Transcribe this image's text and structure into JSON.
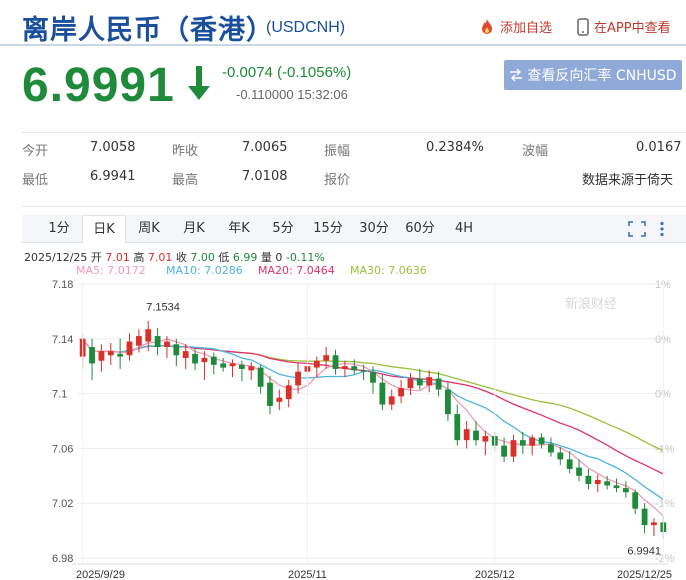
{
  "header": {
    "title": "离岸人民币（香港）",
    "symbol": "(USDCNH)",
    "add_favorite": "添加自选",
    "view_in_app": "在APP中查看"
  },
  "quote": {
    "price": "6.9991",
    "change": "-0.0074 (-0.1056%)",
    "change2": "-0.110000",
    "time": "15:32:06",
    "reverse_label": "查看反向汇率 CNHUSD"
  },
  "stats": {
    "open_label": "今开",
    "open": "7.0058",
    "prev_close_label": "昨收",
    "prev_close": "7.0065",
    "amplitude_label": "振幅",
    "amplitude": "0.2384%",
    "volatility_label": "波幅",
    "volatility": "0.0167",
    "low_label": "最低",
    "low": "6.9941",
    "high_label": "最高",
    "high": "7.0108",
    "quote_label": "报价",
    "source": "数据来源于倚天"
  },
  "tabs": [
    {
      "label": "1分",
      "active": false
    },
    {
      "label": "日K",
      "active": true
    },
    {
      "label": "周K",
      "active": false
    },
    {
      "label": "月K",
      "active": false
    },
    {
      "label": "年K",
      "active": false
    },
    {
      "label": "5分",
      "active": false
    },
    {
      "label": "15分",
      "active": false
    },
    {
      "label": "30分",
      "active": false
    },
    {
      "label": "60分",
      "active": false
    },
    {
      "label": "4H",
      "active": false
    }
  ],
  "ohlc": {
    "date": "2025/12/25",
    "open_label": "开",
    "open": "7.01",
    "high_label": "高",
    "high": "7.01",
    "close_label": "收",
    "close": "7.00",
    "low_label": "低",
    "low": "6.99",
    "volume_label": "量",
    "volume": "0",
    "pct": "-0.11%"
  },
  "ma": {
    "ma5": "MA5: 7.0172",
    "ma10": "MA10: 7.0286",
    "ma20": "MA20: 7.0464",
    "ma30": "MA30: 7.0636"
  },
  "colors": {
    "up": "#d9302a",
    "down": "#1f8a3a",
    "ma5": "#f39ab8",
    "ma10": "#4fb3e0",
    "ma20": "#e0336b",
    "ma30": "#9ac13b",
    "brand": "#1a4f9e"
  },
  "chart_data": {
    "type": "candlestick",
    "y_ticks": [
      "7.18",
      "7.14",
      "7.1",
      "7.06",
      "7.02",
      "6.98"
    ],
    "y_tick_values": [
      7.18,
      7.14,
      7.1,
      7.06,
      7.02,
      6.98
    ],
    "ylim": [
      6.98,
      7.18
    ],
    "right_ticks": [
      "1%",
      "0%",
      "0%",
      "-1%",
      "-1%",
      "-2%"
    ],
    "x_ticks": [
      {
        "label": "2025/9/29",
        "index": 0
      },
      {
        "label": "2025/11",
        "index": 24
      },
      {
        "label": "2025/12",
        "index": 44
      },
      {
        "label": "2025/12/25",
        "index": 62
      }
    ],
    "max_annotation": {
      "label": "7.1534",
      "index": 7,
      "value": 7.1534
    },
    "min_annotation": {
      "label": "6.9941",
      "index": 62,
      "value": 6.9941
    },
    "watermark": "新浪财经",
    "candles": [
      {
        "o": 7.127,
        "h": 7.143,
        "l": 7.118,
        "c": 7.14
      },
      {
        "o": 7.134,
        "h": 7.14,
        "l": 7.11,
        "c": 7.122
      },
      {
        "o": 7.124,
        "h": 7.136,
        "l": 7.116,
        "c": 7.131
      },
      {
        "o": 7.128,
        "h": 7.137,
        "l": 7.121,
        "c": 7.131
      },
      {
        "o": 7.129,
        "h": 7.14,
        "l": 7.118,
        "c": 7.127
      },
      {
        "o": 7.128,
        "h": 7.144,
        "l": 7.124,
        "c": 7.138
      },
      {
        "o": 7.135,
        "h": 7.147,
        "l": 7.13,
        "c": 7.142
      },
      {
        "o": 7.138,
        "h": 7.153,
        "l": 7.131,
        "c": 7.147
      },
      {
        "o": 7.142,
        "h": 7.148,
        "l": 7.128,
        "c": 7.134
      },
      {
        "o": 7.134,
        "h": 7.142,
        "l": 7.126,
        "c": 7.138
      },
      {
        "o": 7.136,
        "h": 7.14,
        "l": 7.12,
        "c": 7.128
      },
      {
        "o": 7.126,
        "h": 7.136,
        "l": 7.118,
        "c": 7.131
      },
      {
        "o": 7.129,
        "h": 7.133,
        "l": 7.117,
        "c": 7.122
      },
      {
        "o": 7.123,
        "h": 7.131,
        "l": 7.11,
        "c": 7.126
      },
      {
        "o": 7.127,
        "h": 7.13,
        "l": 7.114,
        "c": 7.121
      },
      {
        "o": 7.122,
        "h": 7.126,
        "l": 7.116,
        "c": 7.119
      },
      {
        "o": 7.12,
        "h": 7.125,
        "l": 7.112,
        "c": 7.122
      },
      {
        "o": 7.121,
        "h": 7.124,
        "l": 7.109,
        "c": 7.118
      },
      {
        "o": 7.117,
        "h": 7.123,
        "l": 7.11,
        "c": 7.12
      },
      {
        "o": 7.119,
        "h": 7.121,
        "l": 7.1,
        "c": 7.105
      },
      {
        "o": 7.108,
        "h": 7.113,
        "l": 7.085,
        "c": 7.091
      },
      {
        "o": 7.094,
        "h": 7.103,
        "l": 7.088,
        "c": 7.097
      },
      {
        "o": 7.096,
        "h": 7.11,
        "l": 7.09,
        "c": 7.106
      },
      {
        "o": 7.106,
        "h": 7.122,
        "l": 7.1,
        "c": 7.116
      },
      {
        "o": 7.116,
        "h": 7.127,
        "l": 7.108,
        "c": 7.12
      },
      {
        "o": 7.119,
        "h": 7.127,
        "l": 7.112,
        "c": 7.124
      },
      {
        "o": 7.124,
        "h": 7.134,
        "l": 7.118,
        "c": 7.128
      },
      {
        "o": 7.128,
        "h": 7.132,
        "l": 7.114,
        "c": 7.118
      },
      {
        "o": 7.118,
        "h": 7.124,
        "l": 7.112,
        "c": 7.12
      },
      {
        "o": 7.12,
        "h": 7.125,
        "l": 7.114,
        "c": 7.117
      },
      {
        "o": 7.117,
        "h": 7.121,
        "l": 7.11,
        "c": 7.116
      },
      {
        "o": 7.116,
        "h": 7.12,
        "l": 7.1,
        "c": 7.108
      },
      {
        "o": 7.108,
        "h": 7.114,
        "l": 7.088,
        "c": 7.092
      },
      {
        "o": 7.092,
        "h": 7.103,
        "l": 7.088,
        "c": 7.098
      },
      {
        "o": 7.098,
        "h": 7.11,
        "l": 7.093,
        "c": 7.104
      },
      {
        "o": 7.104,
        "h": 7.115,
        "l": 7.099,
        "c": 7.111
      },
      {
        "o": 7.111,
        "h": 7.118,
        "l": 7.103,
        "c": 7.106
      },
      {
        "o": 7.106,
        "h": 7.117,
        "l": 7.101,
        "c": 7.112
      },
      {
        "o": 7.111,
        "h": 7.116,
        "l": 7.098,
        "c": 7.103
      },
      {
        "o": 7.103,
        "h": 7.108,
        "l": 7.08,
        "c": 7.085
      },
      {
        "o": 7.085,
        "h": 7.092,
        "l": 7.062,
        "c": 7.066
      },
      {
        "o": 7.066,
        "h": 7.08,
        "l": 7.06,
        "c": 7.074
      },
      {
        "o": 7.073,
        "h": 7.08,
        "l": 7.062,
        "c": 7.066
      },
      {
        "o": 7.065,
        "h": 7.073,
        "l": 7.055,
        "c": 7.069
      },
      {
        "o": 7.069,
        "h": 7.072,
        "l": 7.058,
        "c": 7.062
      },
      {
        "o": 7.062,
        "h": 7.068,
        "l": 7.05,
        "c": 7.054
      },
      {
        "o": 7.054,
        "h": 7.07,
        "l": 7.05,
        "c": 7.066
      },
      {
        "o": 7.066,
        "h": 7.072,
        "l": 7.056,
        "c": 7.062
      },
      {
        "o": 7.062,
        "h": 7.07,
        "l": 7.055,
        "c": 7.068
      },
      {
        "o": 7.068,
        "h": 7.071,
        "l": 7.06,
        "c": 7.063
      },
      {
        "o": 7.063,
        "h": 7.068,
        "l": 7.054,
        "c": 7.057
      },
      {
        "o": 7.057,
        "h": 7.061,
        "l": 7.048,
        "c": 7.052
      },
      {
        "o": 7.052,
        "h": 7.058,
        "l": 7.042,
        "c": 7.045
      },
      {
        "o": 7.046,
        "h": 7.052,
        "l": 7.036,
        "c": 7.04
      },
      {
        "o": 7.04,
        "h": 7.045,
        "l": 7.03,
        "c": 7.034
      },
      {
        "o": 7.034,
        "h": 7.041,
        "l": 7.028,
        "c": 7.037
      },
      {
        "o": 7.036,
        "h": 7.04,
        "l": 7.03,
        "c": 7.033
      },
      {
        "o": 7.033,
        "h": 7.038,
        "l": 7.028,
        "c": 7.031
      },
      {
        "o": 7.031,
        "h": 7.036,
        "l": 7.024,
        "c": 7.028
      },
      {
        "o": 7.028,
        "h": 7.03,
        "l": 7.012,
        "c": 7.016
      },
      {
        "o": 7.016,
        "h": 7.02,
        "l": 6.998,
        "c": 7.004
      },
      {
        "o": 7.004,
        "h": 7.009,
        "l": 6.996,
        "c": 7.006
      },
      {
        "o": 7.006,
        "h": 7.011,
        "l": 6.994,
        "c": 6.999
      }
    ]
  }
}
